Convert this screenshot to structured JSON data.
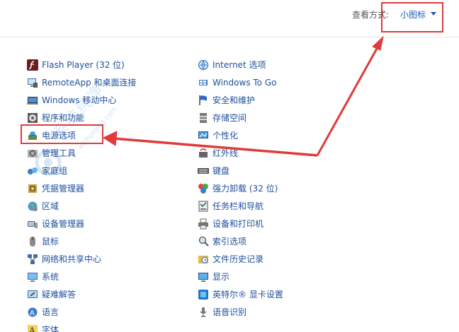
{
  "view": {
    "label": "查看方式:",
    "value": "小图标"
  },
  "left_items": [
    {
      "label": "Flash Player (32 位)",
      "icon": "flash-icon"
    },
    {
      "label": "RemoteApp 和桌面连接",
      "icon": "remoteapp-icon"
    },
    {
      "label": "Windows 移动中心",
      "icon": "mobility-center-icon"
    },
    {
      "label": "程序和功能",
      "icon": "programs-icon"
    },
    {
      "label": "电源选项",
      "icon": "power-icon"
    },
    {
      "label": "管理工具",
      "icon": "admin-tools-icon"
    },
    {
      "label": "家庭组",
      "icon": "homegroup-icon"
    },
    {
      "label": "凭据管理器",
      "icon": "credential-icon"
    },
    {
      "label": "区域",
      "icon": "region-icon"
    },
    {
      "label": "设备管理器",
      "icon": "device-manager-icon"
    },
    {
      "label": "鼠标",
      "icon": "mouse-icon"
    },
    {
      "label": "网络和共享中心",
      "icon": "network-icon"
    },
    {
      "label": "系统",
      "icon": "system-icon"
    },
    {
      "label": "疑难解答",
      "icon": "troubleshoot-icon"
    },
    {
      "label": "语言",
      "icon": "language-icon"
    },
    {
      "label": "字体",
      "icon": "font-icon"
    }
  ],
  "right_items": [
    {
      "label": "Internet 选项",
      "icon": "internet-icon"
    },
    {
      "label": "Windows To Go",
      "icon": "windows-to-go-icon"
    },
    {
      "label": "安全和维护",
      "icon": "security-flag-icon"
    },
    {
      "label": "存储空间",
      "icon": "storage-icon"
    },
    {
      "label": "个性化",
      "icon": "personalization-icon"
    },
    {
      "label": "红外线",
      "icon": "infrared-icon"
    },
    {
      "label": "键盘",
      "icon": "keyboard-icon"
    },
    {
      "label": "强力卸载 (32 位)",
      "icon": "uninstall-icon"
    },
    {
      "label": "任务栏和导航",
      "icon": "taskbar-icon"
    },
    {
      "label": "设备和打印机",
      "icon": "printer-icon"
    },
    {
      "label": "索引选项",
      "icon": "indexing-icon"
    },
    {
      "label": "文件历史记录",
      "icon": "file-history-icon"
    },
    {
      "label": "显示",
      "icon": "display-icon"
    },
    {
      "label": "英特尔® 显卡设置",
      "icon": "intel-graphics-icon"
    },
    {
      "label": "语音识别",
      "icon": "speech-icon"
    }
  ],
  "colors": {
    "link": "#1e4f9b",
    "annotation": "#e03a3a"
  },
  "watermark": {
    "text": "系统纯净",
    "sub": "aichunjing.com"
  }
}
